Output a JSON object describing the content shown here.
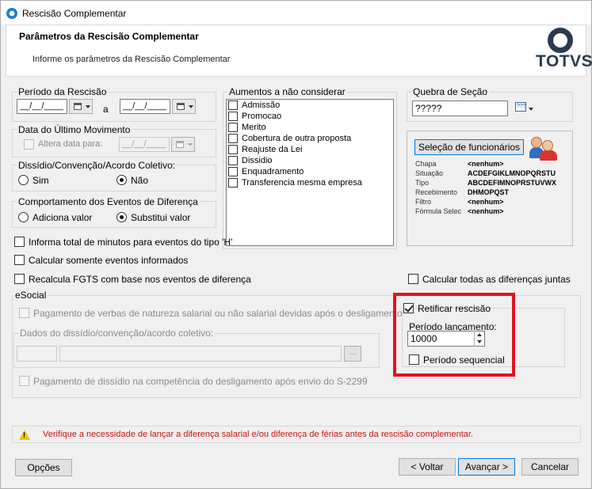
{
  "window": {
    "title": "Rescisão Complementar"
  },
  "header": {
    "title": "Parâmetros da Rescisão Complementar",
    "subtitle": "Informe os parâmetros da Rescisão Complementar",
    "logo_text": "TOTVS"
  },
  "periodo": {
    "label": "Período da Rescisão",
    "from_value": "__/__/____",
    "separator": "a",
    "to_value": "__/__/____"
  },
  "ultimo_mov": {
    "label": "Data do Último Movimento",
    "altera_label": "Altera data para:",
    "altera_checked": false,
    "date_value": "__/__/____"
  },
  "dissidio": {
    "label": "Dissídio/Convenção/Acordo Coletivo:",
    "options": [
      "Sim",
      "Não"
    ],
    "selected": "Não"
  },
  "comportamento": {
    "label": "Comportamento dos Eventos de Diferença",
    "options": [
      "Adiciona valor",
      "Substitui valor"
    ],
    "selected": "Substitui valor"
  },
  "aumentos": {
    "label": "Aumentos a não considerar",
    "items": [
      "Admissão",
      "Promocao",
      "Merito",
      "Cobertura de outra proposta",
      "Reajuste da Lei",
      "Dissidio",
      "Enquadramento",
      "Transferencia mesma empresa"
    ]
  },
  "quebra": {
    "label": "Quebra de Seção",
    "value": "?????"
  },
  "selecao": {
    "button_label": "Seleção de funcionários",
    "fields": [
      {
        "key": "Chapa",
        "value": "<nenhum>"
      },
      {
        "key": "Situação",
        "value": "ACDEFGIKLMNOPQRSTU"
      },
      {
        "key": "Tipo",
        "value": "ABCDEFIMNOPRSTUVWX"
      },
      {
        "key": "Recebimento",
        "value": "DHMOPQST"
      },
      {
        "key": "Filtro",
        "value": "<nenhum>"
      },
      {
        "key": "Fórmula Selec",
        "value": "<nenhum>"
      }
    ]
  },
  "options": {
    "informa_total": "Informa total de minutos para eventos do tipo 'H'",
    "calcular_somente": "Calcular somente eventos informados",
    "recalcula_fgts": "Recalcula FGTS com base nos eventos de diferença",
    "calcular_todas": "Calcular todas as diferenças juntas"
  },
  "esocial": {
    "label": "eSocial",
    "pagamento_verbas": "Pagamento de verbas de natureza salarial ou não salarial devidas após o desligamento",
    "dados_label": "Dados do dissídio/convenção/acordo coletivo:",
    "pagamento_dissidio": "Pagamento de dissídio na competência do desligamento após envio do S-2299"
  },
  "retificar": {
    "label": "Retificar rescisão",
    "checked": true,
    "periodo_label": "Período lançamento:",
    "periodo_value": "10000",
    "sequencial_label": "Período sequencial",
    "sequencial_checked": false
  },
  "warning": {
    "text": "Verifique a necessidade de lançar a diferença salarial e/ou diferença de férias antes da rescisão complementar."
  },
  "footer": {
    "opcoes": "Opções",
    "voltar": "< Voltar",
    "avancar": "Avançar >",
    "cancelar": "Cancelar"
  },
  "colors": {
    "accent": "#0078d7",
    "highlight": "#e0141e",
    "warning_text": "#d01010",
    "logo": "#2a3a4e"
  }
}
